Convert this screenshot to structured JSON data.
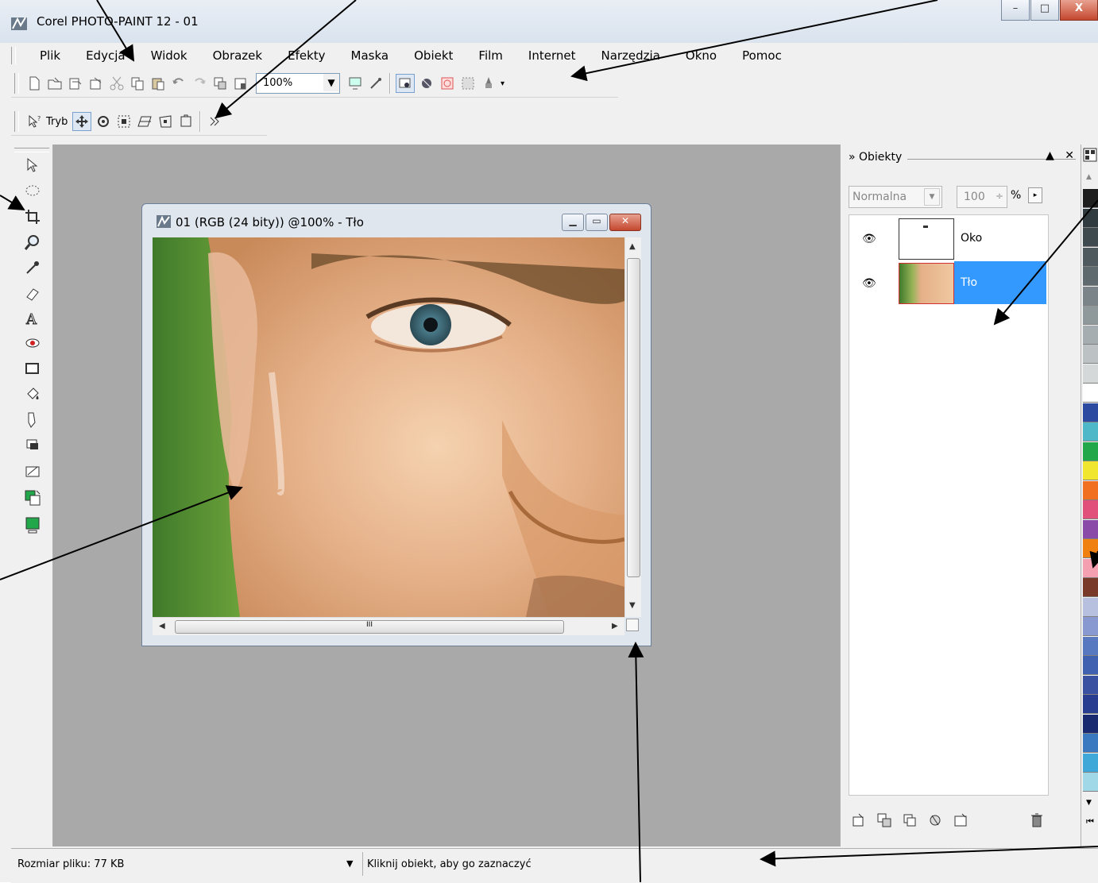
{
  "app": {
    "title": "Corel PHOTO-PAINT 12 - 01",
    "window_buttons": {
      "minimize": "–",
      "maximize": "□",
      "close": "X"
    }
  },
  "menu": [
    "Plik",
    "Edycja",
    "Widok",
    "Obrazek",
    "Efekty",
    "Maska",
    "Obiekt",
    "Film",
    "Internet",
    "Narzędzia",
    "Okno",
    "Pomoc"
  ],
  "toolbar1": {
    "zoom_value": "100%",
    "icons": [
      "new-document-icon",
      "open-icon",
      "import-icon",
      "export-icon",
      "cut-icon",
      "copy-icon",
      "paste-icon",
      "undo-icon",
      "redo-icon",
      "copy-to-file-icon",
      "paste-as-document-icon",
      "full-screen-preview-icon",
      "brush-icon",
      "object-marquee-icon",
      "mask-overlay-icon",
      "mask-visible-icon",
      "mask-marquee-icon",
      "launch-icon"
    ]
  },
  "toolbar2": {
    "mode_label": "Tryb",
    "icons": [
      "pick-help-icon",
      "move-mode-icon",
      "rotate-mode-icon",
      "scale-mode-icon",
      "skew-mode-icon",
      "distort-mode-icon",
      "perspective-mode-icon",
      "more-icon"
    ]
  },
  "toolbox": [
    "pick-tool-icon",
    "mask-tool-icon",
    "crop-tool-icon",
    "zoom-tool-icon",
    "eyedropper-tool-icon",
    "eraser-tool-icon",
    "text-tool-icon",
    "red-eye-tool-icon",
    "rectangle-tool-icon",
    "fill-tool-icon",
    "paint-tool-icon",
    "effect-tool-icon",
    "image-sprayer-icon",
    "color-swap-icon",
    "fill-color-icon"
  ],
  "document": {
    "title": "01 (RGB (24 bity)) @100% - Tło",
    "hscroll_grip": "III"
  },
  "objects_docker": {
    "title": "Obiekty",
    "blend_mode": "Normalna",
    "opacity": "100",
    "opacity_unit": "%",
    "objects": [
      {
        "name": "Oko",
        "visible": true,
        "selected": false
      },
      {
        "name": "Tło",
        "visible": true,
        "selected": true
      }
    ],
    "bottom_icons": [
      "new-object-icon",
      "new-from-mask-icon",
      "combine-icon",
      "lens-icon",
      "clip-mask-icon",
      "delete-icon"
    ]
  },
  "palette": {
    "colors": [
      "#1e1e1e",
      "#2f3b3f",
      "#3e4a4e",
      "#4e5a5e",
      "#5f6a6e",
      "#7b8589",
      "#8f989b",
      "#a6adb0",
      "#bcc2c4",
      "#d4d8d9",
      "#ffffff",
      "#2b4aa0",
      "#4fb8c8",
      "#22a84a",
      "#f0e630",
      "#f07020",
      "#e0507a",
      "#8a4aa8",
      "#f08010",
      "#f4a0b0",
      "#7a3a2a",
      "#b8c0e0",
      "#8898d0",
      "#5878c0",
      "#4060b0",
      "#3a50a0",
      "#283c90",
      "#1a2a70",
      "#3a78c0",
      "#40a8d8",
      "#a0d8e8"
    ]
  },
  "status": {
    "file_size": "Rozmiar pliku: 77 KB",
    "hint": "Kliknij obiekt, aby go zaznaczyć"
  }
}
